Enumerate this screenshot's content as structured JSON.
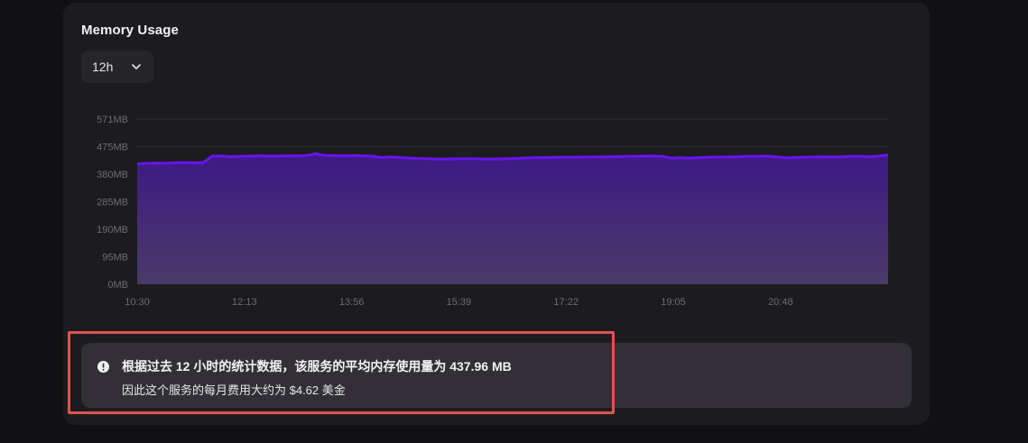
{
  "card": {
    "title": "Memory Usage"
  },
  "range_select": {
    "value": "12h",
    "icon": "chevron-down-icon"
  },
  "chart_data": {
    "type": "area",
    "title": "",
    "xlabel": "",
    "ylabel": "",
    "y_ticks": [
      "0MB",
      "95MB",
      "190MB",
      "285MB",
      "380MB",
      "475MB",
      "571MB"
    ],
    "ylim": [
      0,
      571
    ],
    "x_ticks": [
      "10:30",
      "12:13",
      "13:56",
      "15:39",
      "17:22",
      "19:05",
      "20:48"
    ],
    "grid": "horizontal",
    "line_color": "#6a12f0",
    "fill_top_color": "#3d1a86",
    "fill_bottom_color": "#4a3a68",
    "series": [
      {
        "values": [
          416,
          418,
          419,
          418,
          420,
          421,
          420,
          420,
          443,
          443,
          441,
          442,
          443,
          444,
          443,
          443,
          444,
          444,
          445,
          451,
          445,
          445,
          444,
          445,
          444,
          443,
          438,
          440,
          438,
          436,
          435,
          434,
          433,
          433,
          434,
          434,
          434,
          433,
          433,
          434,
          435,
          436,
          437,
          438,
          438,
          439,
          439,
          439,
          440,
          440,
          441,
          441,
          442,
          442,
          443,
          443,
          442,
          436,
          437,
          436,
          438,
          439,
          440,
          440,
          441,
          442,
          442,
          443,
          441,
          437,
          438,
          439,
          440,
          441,
          440,
          441,
          442,
          442,
          441,
          443,
          447
        ]
      }
    ]
  },
  "notice": {
    "icon": "alert-circle-icon",
    "line1": "根据过去 12 小时的统计数据，该服务的平均内存使用量为 437.96 MB",
    "line2": "因此这个服务的每月费用大约为 $4.62 美金"
  }
}
